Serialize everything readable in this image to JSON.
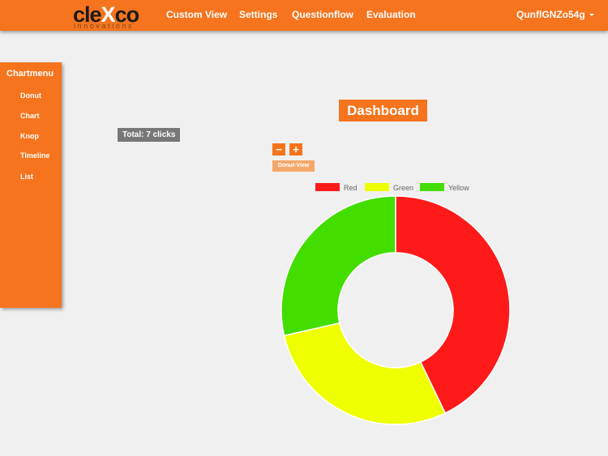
{
  "logo": {
    "brand_pre": "cle",
    "brand_x": "X",
    "brand_post": "co",
    "tagline": "innovations"
  },
  "nav": {
    "items": [
      {
        "label": "Custom View"
      },
      {
        "label": "Settings"
      },
      {
        "label": "Questionflow"
      },
      {
        "label": "Evaluation"
      }
    ],
    "user": "QunflGNZo54g"
  },
  "sidebar": {
    "title": "Chartmenu",
    "items": [
      {
        "label": "Donut"
      },
      {
        "label": "Chart"
      },
      {
        "label": "Knop"
      },
      {
        "label": "Timeline"
      },
      {
        "label": "List"
      }
    ]
  },
  "dashboard": {
    "title": "Dashboard",
    "total": "Total: 7 clicks",
    "zoom_out": "−",
    "zoom_in": "+",
    "view_label": "Donut-View"
  },
  "chart_data": {
    "type": "pie",
    "categories": [
      "Red",
      "Green",
      "Yellow"
    ],
    "values": [
      3,
      2,
      2
    ],
    "colors": [
      "#ff1a1a",
      "#f0ff00",
      "#44dd00"
    ],
    "legend_placement": "top"
  }
}
